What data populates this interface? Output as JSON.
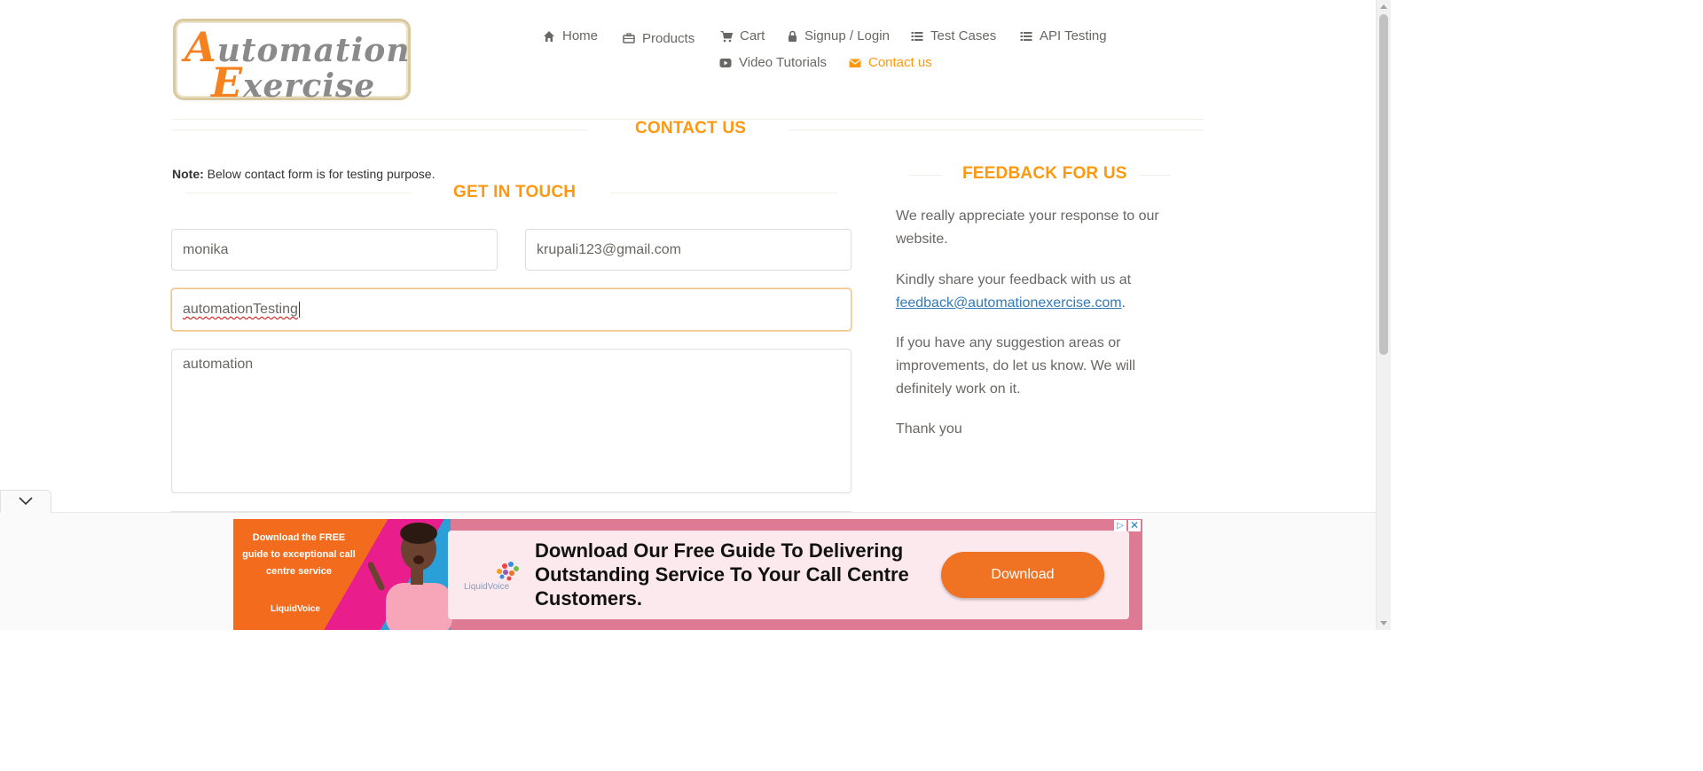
{
  "logo": {
    "line1_cap": "A",
    "line1_rest": "utomation",
    "line2_cap": "E",
    "line2_rest": "xercise"
  },
  "nav": {
    "home": "Home",
    "products": "Products",
    "cart": "Cart",
    "signup_login": "Signup / Login",
    "test_cases": "Test Cases",
    "api_testing": "API Testing",
    "video_tutorials": "Video Tutorials",
    "contact_us": "Contact us"
  },
  "page": {
    "title": "CONTACT US",
    "note_label": "Note:",
    "note_text": " Below contact form is for testing purpose.",
    "form_title": "GET IN TOUCH",
    "feedback_title": "FEEDBACK FOR US"
  },
  "form": {
    "name": "monika",
    "email": "krupali123@gmail.com",
    "subject": "automationTesting",
    "message": "automation"
  },
  "feedback": {
    "p1": "We really appreciate your response to our website.",
    "p2_prefix": "Kindly share your feedback with us at",
    "p2_email": "feedback@automationexercise.com",
    "p2_suffix": ".",
    "p3": "If you have any suggestion areas or improvements, do let us know. We will definitely work on it.",
    "p4": "Thank you"
  },
  "ad": {
    "left_text": "Download the FREE guide to exceptional call centre service",
    "brand_small": "LiquidVoice",
    "brand": "LiquidVoice",
    "headline": "Download Our Free Guide To Delivering Outstanding Service To Your Call Centre Customers.",
    "button": "Download",
    "info": "▷",
    "close": "✕"
  },
  "colors": {
    "accent": "#fe980f",
    "link": "#337ab7",
    "ad_button": "#f07223"
  }
}
